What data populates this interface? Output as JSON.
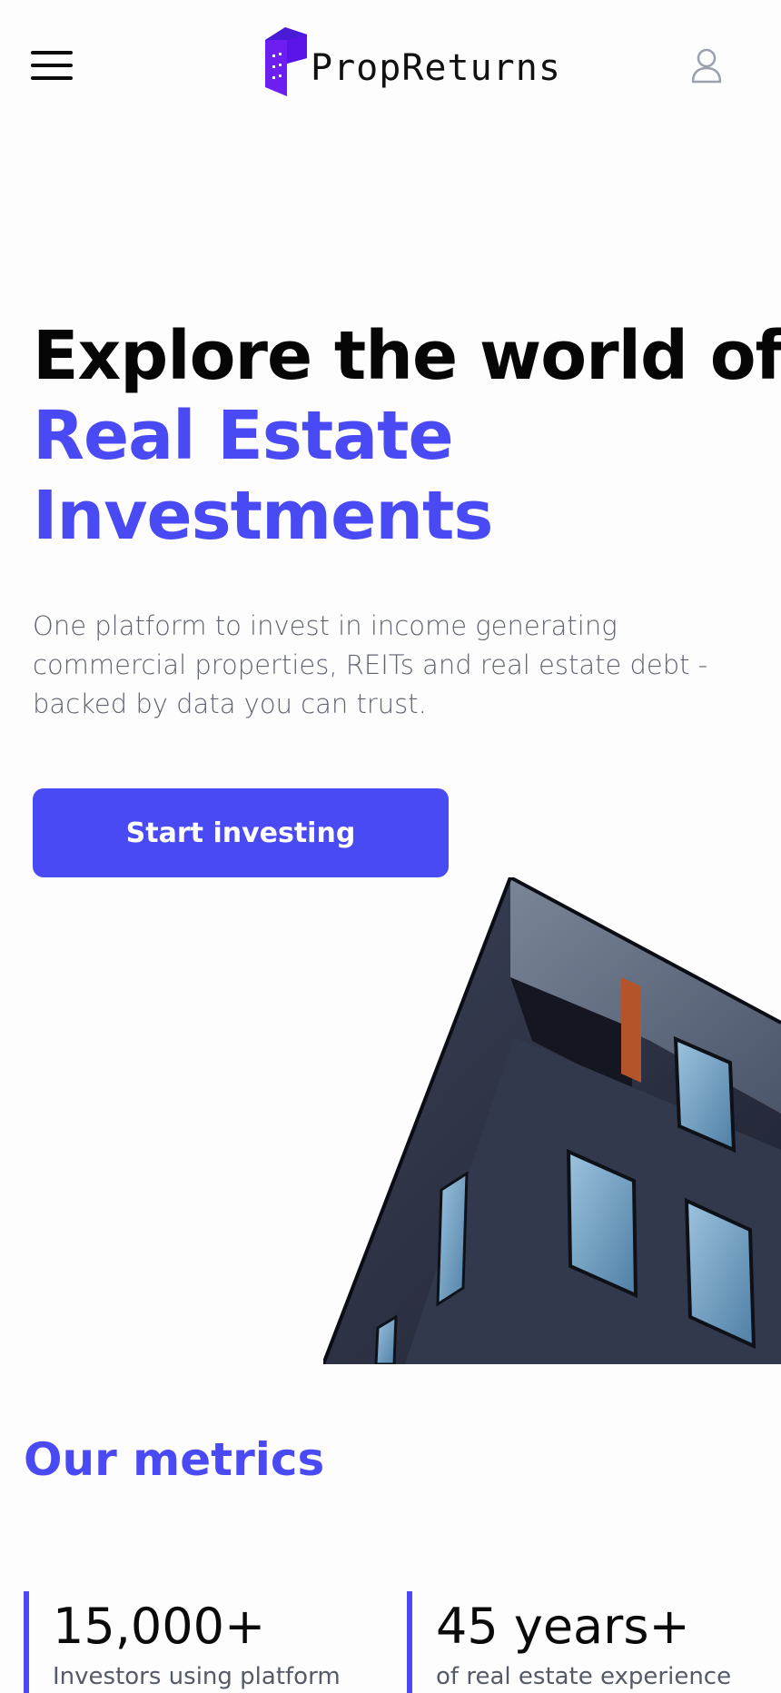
{
  "header": {
    "logo_text": "PropReturns",
    "menu_icon": "hamburger-menu-icon",
    "user_icon": "user-account-icon"
  },
  "hero": {
    "title_line1": "Explore the world of",
    "title_line2": "Real Estate",
    "title_line3": "Investments",
    "subtitle": "One platform to invest in income generating commercial properties, REITs and real estate debt - backed by data you can trust.",
    "cta_label": "Start investing",
    "image_subject": "modern-building-photo"
  },
  "metrics": {
    "title": "Our metrics",
    "items": [
      {
        "value": "15,000+",
        "label": "Investors using platform"
      },
      {
        "value": "45 years+",
        "label": "of real estate experience"
      }
    ]
  },
  "colors": {
    "accent": "#4a4af4",
    "text_dark": "#060606",
    "text_muted": "#5f6470",
    "background": "#fdfdfe"
  }
}
